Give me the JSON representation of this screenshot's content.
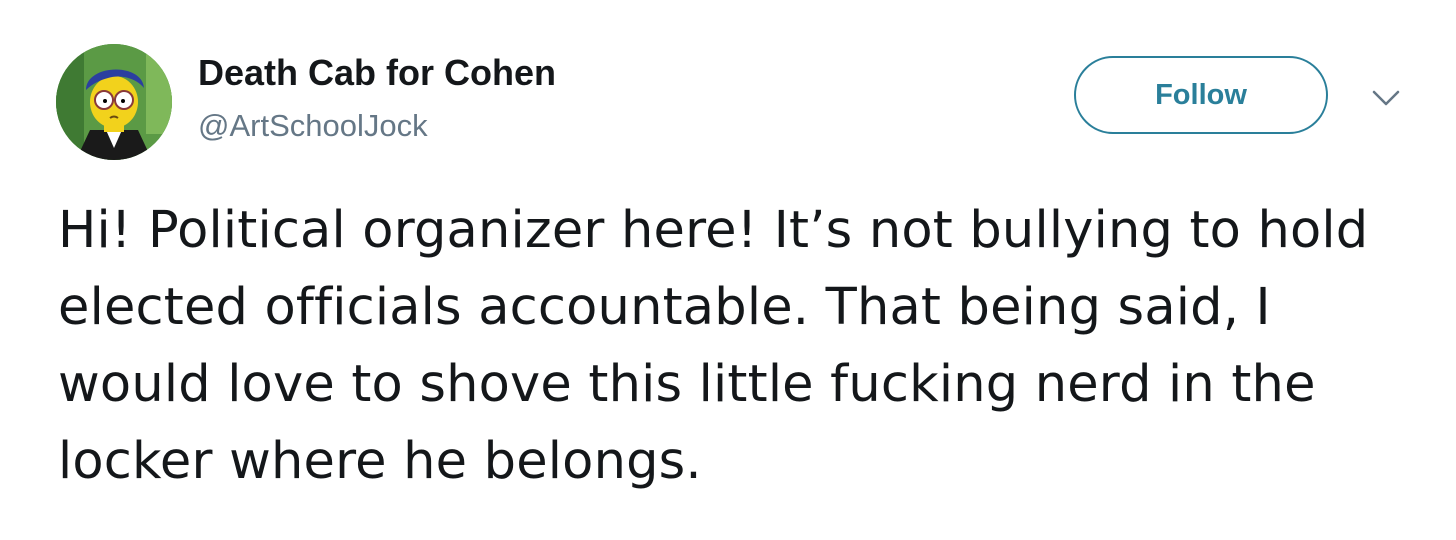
{
  "user": {
    "display_name": "Death Cab for Cohen",
    "handle": "@ArtSchoolJock",
    "avatar": "cartoon-character-avatar"
  },
  "actions": {
    "follow_label": "Follow",
    "more_icon": "chevron-down-icon"
  },
  "tweet": {
    "text": "Hi! Political organizer here! It’s not bullying to hold elected officials accountable. That being said, I would love to shove this little fucking nerd in the locker where he belongs."
  },
  "colors": {
    "accent": "#2a7f9a",
    "text": "#14171a",
    "muted": "#657786"
  }
}
